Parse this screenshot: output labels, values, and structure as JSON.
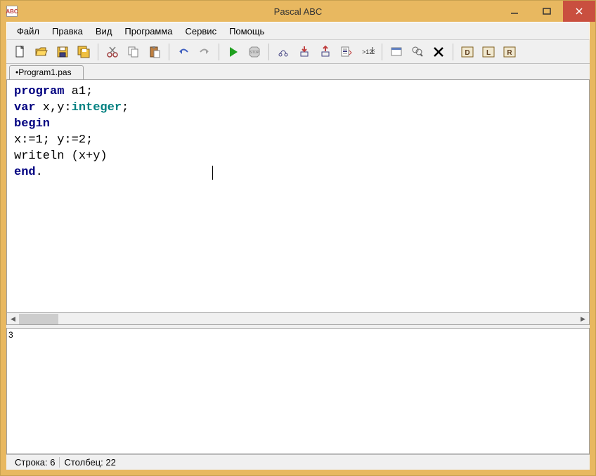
{
  "app_icon_text": "ABC",
  "title": "Pascal ABC",
  "menu": [
    "Файл",
    "Правка",
    "Вид",
    "Программа",
    "Сервис",
    "Помощь"
  ],
  "tab": "•Program1.pas",
  "code": {
    "l1_kw": "program",
    "l1_rest": " a1;",
    "l2_kw": "var",
    "l2_mid": " x,y:",
    "l2_ty": "integer",
    "l2_end": ";",
    "l3_kw": "begin",
    "l4": "x:=1; y:=2;",
    "l5": "writeln (x+y)",
    "l6_kw": "end",
    "l6_end": "."
  },
  "output": "3",
  "status": {
    "line_label": "Строка: ",
    "line": "6",
    "col_label": "Столбец: ",
    "col": "22"
  },
  "scroll": {
    "left_arrow": "◀",
    "right_arrow": "▶"
  },
  "colors": {
    "titlebar": "#e8b860",
    "close": "#c94f3f",
    "keyword": "#000080",
    "type": "#008080"
  }
}
